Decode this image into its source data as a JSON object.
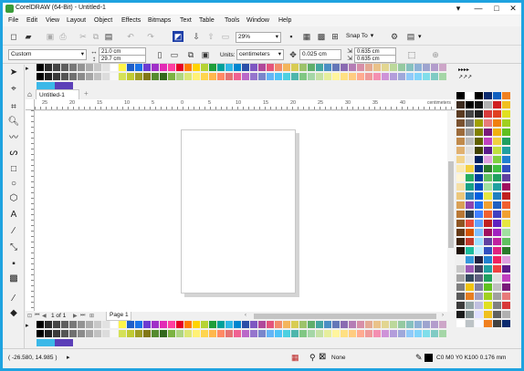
{
  "window": {
    "title": "CorelDRAW (64-Bit) - Untitled-1",
    "controls": [
      "▾",
      "—",
      "□",
      "✕"
    ]
  },
  "menu": [
    "File",
    "Edit",
    "View",
    "Layout",
    "Object",
    "Effects",
    "Bitmaps",
    "Text",
    "Table",
    "Tools",
    "Window",
    "Help"
  ],
  "toolbar": {
    "zoom": "29%",
    "snap": "Snap To"
  },
  "propbar": {
    "page_size": "Custom",
    "width": "21.0 cm",
    "height": "29.7 cm",
    "units_label": "Units:",
    "units": "centimeters",
    "nudge": "0.025 cm",
    "dup_x": "0.635 cm",
    "dup_y": "0.635 cm"
  },
  "doc_tab": {
    "label": "Untitled-1",
    "add": "+"
  },
  "ruler": {
    "unit": "centimeters",
    "h_ticks": [
      "25",
      "20",
      "15",
      "10",
      "5",
      "0",
      "5",
      "10",
      "15",
      "20",
      "25",
      "30",
      "35",
      "40"
    ]
  },
  "page_nav": {
    "text": "1 of 1",
    "page_tab": "Page 1"
  },
  "status": {
    "coords": "( -26.580, 14.985 )",
    "fill": "None",
    "outline": "C0 M0 Y0 K100  0.176 mm"
  },
  "colors": {
    "palette_top": [
      "#000000",
      "#2b2b2b",
      "#444444",
      "#5e5e5e",
      "#787878",
      "#939393",
      "#adadad",
      "#c8c8c8",
      "#e2e2e2",
      "#ffffff",
      "#fff44a",
      "#1e5ec8",
      "#1a73e8",
      "#6c3bd2",
      "#a030c8",
      "#e22bb5",
      "#ff3ea0",
      "#e60026",
      "#ff7a00",
      "#ffd400",
      "#b5d334",
      "#1f9e3a",
      "#00a19a",
      "#2fb8e6",
      "#0086cf",
      "#2b4fa8",
      "#7e57c2",
      "#b0489b",
      "#e4547c",
      "#f28c6b",
      "#f4b55c",
      "#d8cc52",
      "#9dc36b",
      "#5fae6b",
      "#43a6a0",
      "#4a8fc4",
      "#6477b8",
      "#8a6bb2",
      "#b47db5",
      "#d78fa8",
      "#e4a993",
      "#eac28a",
      "#e2d691",
      "#bcd89b",
      "#95c9a1",
      "#86c1bf",
      "#8eb1d6",
      "#9ea4cf",
      "#b39dcc",
      "#cda6c8"
    ],
    "palette_top2": [
      "#000000",
      "#1f1f1f",
      "#3a3a3a",
      "#555555",
      "#707070",
      "#8b8b8b",
      "#a6a6a6",
      "#c1c1c1",
      "#dcdcdc",
      "#f7f7f7",
      "#d4e157",
      "#c0ca33",
      "#9e9d24",
      "#827717",
      "#558b2f",
      "#33691e",
      "#7cb342",
      "#aed581",
      "#dce775",
      "#fff176",
      "#ffd54f",
      "#ffb74d",
      "#ff8a65",
      "#e57373",
      "#f06292",
      "#ba68c8",
      "#9575cd",
      "#7986cb",
      "#64b5f6",
      "#4fc3f7",
      "#4dd0e1",
      "#4db6ac",
      "#81c784",
      "#a5d6a7",
      "#c5e1a5",
      "#e6ee9c",
      "#fff59d",
      "#ffe082",
      "#ffcc80",
      "#ffab91",
      "#ef9a9a",
      "#f48fb1",
      "#ce93d8",
      "#b39ddb",
      "#9fa8da",
      "#90caf9",
      "#81d4fa",
      "#80deea",
      "#80cbc4",
      "#a5d6a7"
    ],
    "palette_bottom": [
      "#000000",
      "#2b2b2b",
      "#444444",
      "#5e5e5e",
      "#787878",
      "#939393",
      "#adadad",
      "#c8c8c8",
      "#e2e2e2",
      "#ffffff",
      "#fff44a",
      "#1e5ec8",
      "#1a73e8",
      "#6c3bd2",
      "#a030c8",
      "#e22bb5",
      "#ff3ea0",
      "#e60026",
      "#ff7a00",
      "#ffd400",
      "#b5d334",
      "#1f9e3a",
      "#00a19a",
      "#2fb8e6",
      "#0086cf",
      "#2b4fa8",
      "#7e57c2",
      "#b0489b",
      "#e4547c",
      "#f28c6b",
      "#f4b55c",
      "#d8cc52",
      "#9dc36b",
      "#5fae6b",
      "#43a6a0",
      "#4a8fc4",
      "#6477b8",
      "#8a6bb2",
      "#b47db5",
      "#d78fa8",
      "#e4a993",
      "#eac28a",
      "#e2d691",
      "#bcd89b",
      "#95c9a1",
      "#86c1bf",
      "#8eb1d6",
      "#9ea4cf",
      "#b39dcc",
      "#cda6c8"
    ],
    "right_col1": [
      "#000000",
      "#3b2a1e",
      "#5a3b22",
      "#7a5230",
      "#9c6b3c",
      "#c08a4c",
      "#e0b070",
      "#f2d38c",
      "#fbe9b0",
      "#fff5d6",
      "#f6e0a6",
      "#ecc77b",
      "#d9a056",
      "#b97836",
      "#8e5523",
      "#663a17",
      "#3f230e",
      "#1e1209",
      "#efefef",
      "#c9c9c9",
      "#a5a5a5",
      "#7f7f7f",
      "#5a5a5a",
      "#3a3a3a",
      "#1a1a1a",
      "#ffffff"
    ],
    "right_col2": [
      "#ffffff",
      "#000000",
      "#444444",
      "#777777",
      "#999999",
      "#bbbbbb",
      "#dddddd",
      "#e6e6e6",
      "#f4d03f",
      "#27ae60",
      "#16a085",
      "#2980b9",
      "#8e44ad",
      "#2c3e50",
      "#e74c3c",
      "#d35400",
      "#c0392b",
      "#1abc9c",
      "#3498db",
      "#9b59b6",
      "#34495e",
      "#f1c40f",
      "#e67e22",
      "#95a5a6",
      "#7f8c8d",
      "#bdc3c7"
    ],
    "right_col3": [
      "#000000",
      "#101010",
      "#202020",
      "#a0a000",
      "#808000",
      "#606000",
      "#404000",
      "#002060",
      "#003080",
      "#0040a0",
      "#0050c0",
      "#0060e0",
      "#2070f0",
      "#4080ff",
      "#60a0ff",
      "#80c0ff",
      "#a0e0ff",
      "#c0f0ff",
      "#202040",
      "#404060",
      "#606080",
      "#8080a0",
      "#a0a0c0",
      "#c0c0e0",
      "#e0e0ff",
      "#f8f8ff"
    ],
    "right_col4": [
      "#0b2a6e",
      "#b0b0b0",
      "#d83a3a",
      "#e87a7a",
      "#7a1a7a",
      "#c040c0",
      "#5a1a8a",
      "#e0a0e0",
      "#2a7a2a",
      "#60c060",
      "#a0e0a0",
      "#e6e640",
      "#f0a030",
      "#f06030",
      "#c02020",
      "#a01060",
      "#6040a0",
      "#3050c0",
      "#2080d0",
      "#20a0a0",
      "#20a060",
      "#60c020",
      "#a0d020",
      "#e0e020",
      "#f0c020",
      "#f08020"
    ],
    "right_col5": [
      "#1060c0",
      "#d02020",
      "#e04020",
      "#f08010",
      "#f0b010",
      "#f0d040",
      "#c0e040",
      "#80d040",
      "#40c040",
      "#20a060",
      "#20a0a0",
      "#2080c0",
      "#2060c0",
      "#4040c0",
      "#6020c0",
      "#a020c0",
      "#c020a0",
      "#e02080",
      "#f02060",
      "#f04040",
      "#e0e0e0",
      "#c0c0c0",
      "#a0a0a0",
      "#808080",
      "#606060",
      "#404040"
    ]
  }
}
